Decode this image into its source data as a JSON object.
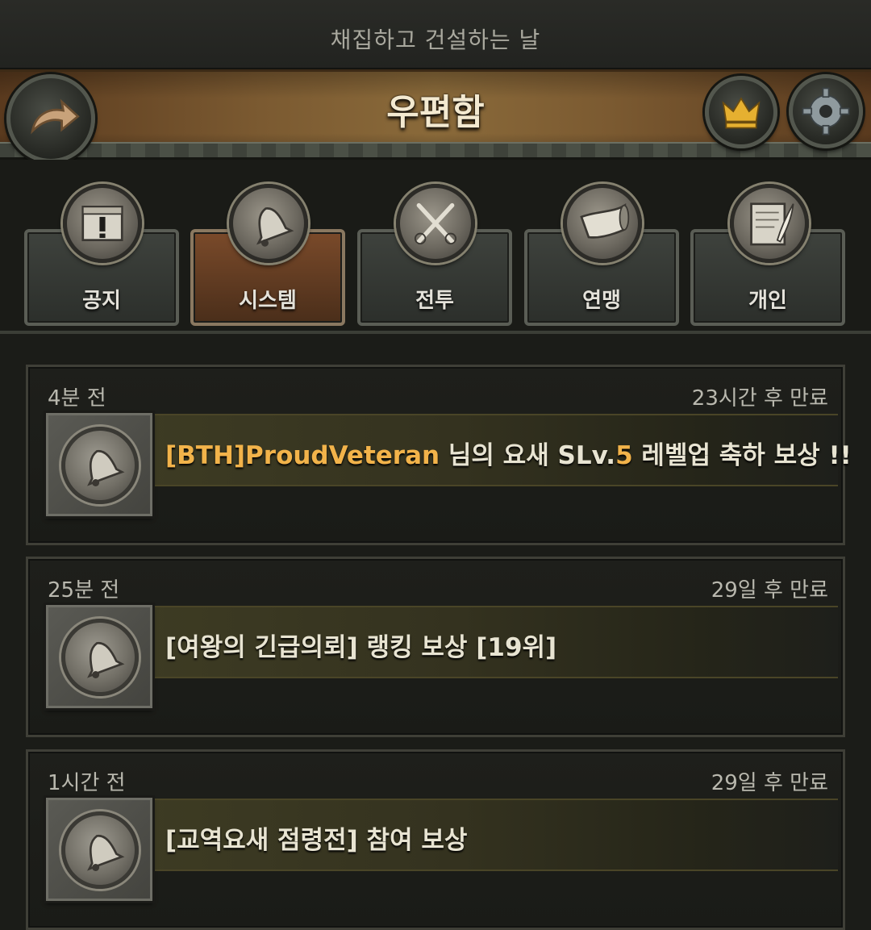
{
  "event_banner": {
    "text": "채집하고 건설하는 날"
  },
  "header": {
    "title": "우편함"
  },
  "tabs": [
    {
      "label": "공지",
      "icon": "notice-chest-icon",
      "active": false
    },
    {
      "label": "시스템",
      "icon": "bell-icon",
      "active": true
    },
    {
      "label": "전투",
      "icon": "crossed-swords-icon",
      "active": false
    },
    {
      "label": "연맹",
      "icon": "horn-icon",
      "active": false
    },
    {
      "label": "개인",
      "icon": "letter-quill-icon",
      "active": false
    }
  ],
  "mails": [
    {
      "time": "4분 전",
      "expire": "23시간 후 만료",
      "subject_highlight": "[BTH]ProudVeteran",
      "subject_mid": " 님의 요새 SLv.",
      "subject_level": "5",
      "subject_tail": " 레벨업 축하 보상 !!",
      "icon": "bell-icon"
    },
    {
      "time": "25분 전",
      "expire": "29일 후 만료",
      "subject": "[여왕의 긴급의뢰] 랭킹 보상 [19위]",
      "icon": "bell-icon"
    },
    {
      "time": "1시간 전",
      "expire": "29일 후 만료",
      "subject": "[교역요새 점령전] 참여 보상",
      "icon": "bell-icon"
    }
  ],
  "colors": {
    "highlight_gold": "#f2b34a",
    "active_tab": "#7a4a2a",
    "title_bar": "#7b5a31"
  }
}
